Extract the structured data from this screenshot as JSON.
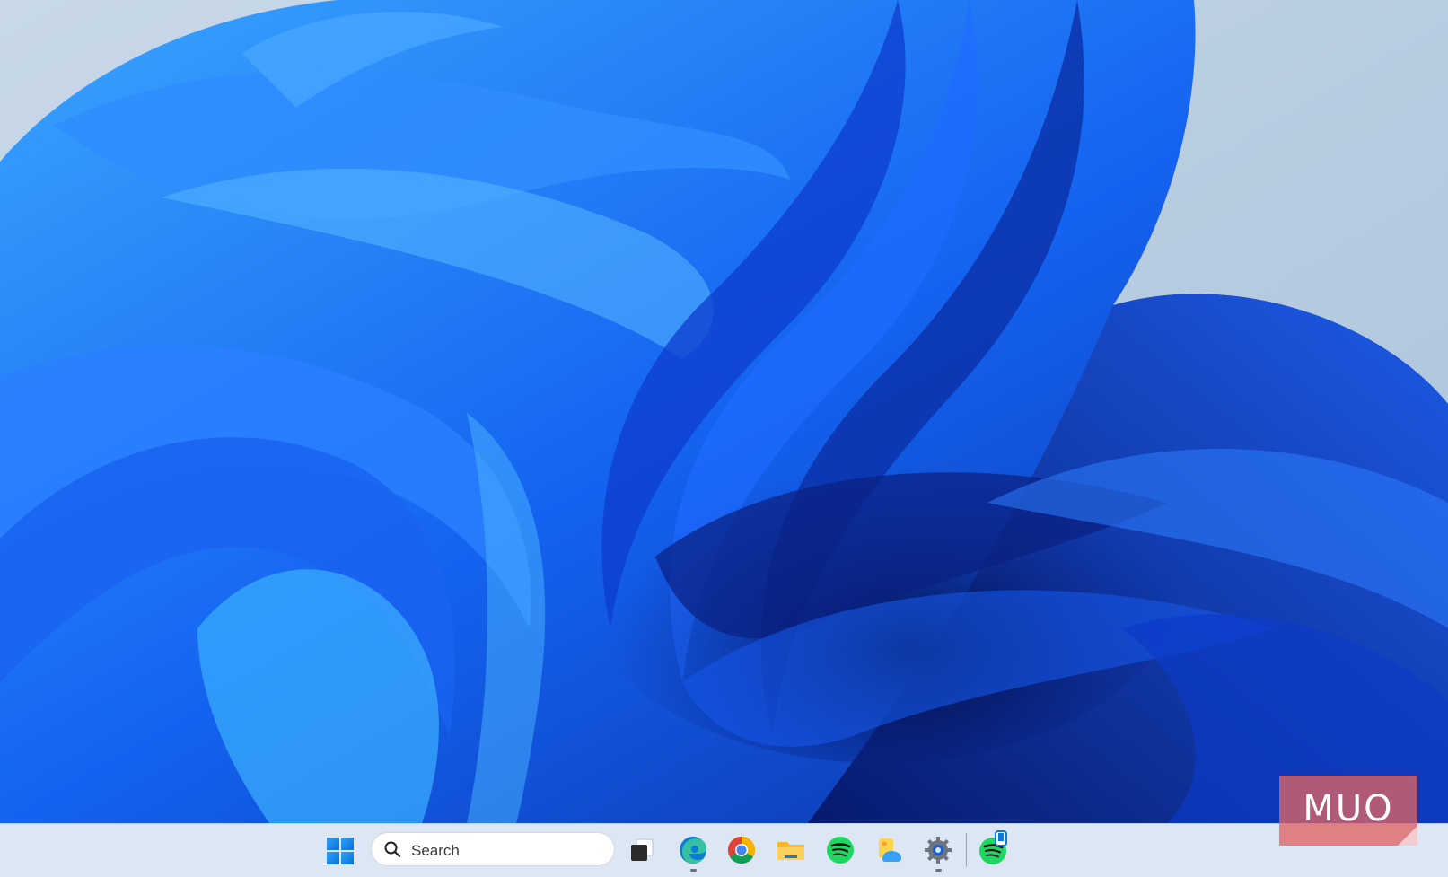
{
  "desktop": {
    "wallpaper": "windows-11-bloom",
    "colors": {
      "sky": "#b9cde0",
      "bloom_dark": "#0a2a9c",
      "bloom_mid": "#1463f0",
      "bloom_light": "#3aa6ff"
    }
  },
  "taskbar": {
    "background": "#dde6f3",
    "start_icon": "windows-start-icon",
    "search": {
      "placeholder": "Search",
      "icon": "search-icon"
    },
    "apps": [
      {
        "name": "task-view",
        "icon": "task-view-icon",
        "running": false
      },
      {
        "name": "edge",
        "icon": "edge-icon",
        "running": true
      },
      {
        "name": "chrome",
        "icon": "chrome-icon",
        "running": false
      },
      {
        "name": "file-explorer",
        "icon": "folder-icon",
        "running": false
      },
      {
        "name": "spotify",
        "icon": "spotify-icon",
        "running": false
      },
      {
        "name": "photos",
        "icon": "photos-icon",
        "running": false
      },
      {
        "name": "settings",
        "icon": "gear-icon",
        "running": true
      },
      {
        "name": "spotify-pinned",
        "icon": "spotify-icon",
        "running": false,
        "badge": "phone-badge-icon"
      }
    ]
  },
  "watermark": {
    "text": "MUO"
  }
}
